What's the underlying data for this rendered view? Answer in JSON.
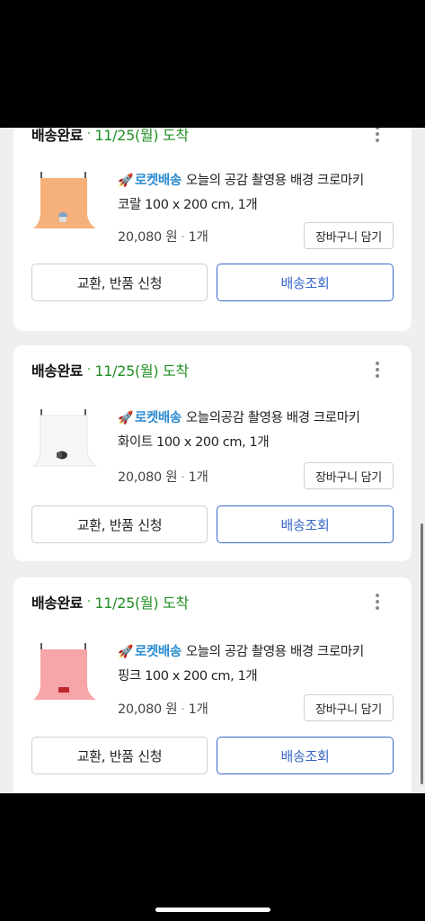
{
  "orders": [
    {
      "status": "배송완료",
      "dot": "·",
      "arrival": "11/25(월) 도착",
      "rocket_icon": "🚀",
      "badge": "로켓배송",
      "product_line1": "오늘의 공감 촬영용 배경 크로마키",
      "product_line2": "코랄 100 x 200 cm, 1개",
      "price": "20,080 원",
      "sep": "·",
      "qty": "1개",
      "cart_label": "장바구니 담기",
      "exchange_label": "교환, 반품 신청",
      "track_label": "배송조회",
      "thumb_color": "#f6b07a"
    },
    {
      "status": "배송완료",
      "dot": "·",
      "arrival": "11/25(월) 도착",
      "rocket_icon": "🚀",
      "badge": "로켓배송",
      "product_line1": "오늘의공감 촬영용 배경 크로마키",
      "product_line2": "화이트 100 x 200 cm, 1개",
      "price": "20,080 원",
      "sep": "·",
      "qty": "1개",
      "cart_label": "장바구니 담기",
      "exchange_label": "교환, 반품 신청",
      "track_label": "배송조회",
      "thumb_color": "#f7f7f7"
    },
    {
      "status": "배송완료",
      "dot": "·",
      "arrival": "11/25(월) 도착",
      "rocket_icon": "🚀",
      "badge": "로켓배송",
      "product_line1": "오늘의 공감 촬영용 배경 크로마키",
      "product_line2": "핑크 100 x 200 cm, 1개",
      "price": "20,080 원",
      "sep": "·",
      "qty": "1개",
      "cart_label": "장바구니 담기",
      "exchange_label": "교환, 반품 신청",
      "track_label": "배송조회",
      "thumb_color": "#f7a5a8"
    }
  ],
  "colors": {
    "arrival_green": "#1f8f22",
    "badge_blue": "#2a8ad0",
    "track_blue": "#3a67c8"
  }
}
